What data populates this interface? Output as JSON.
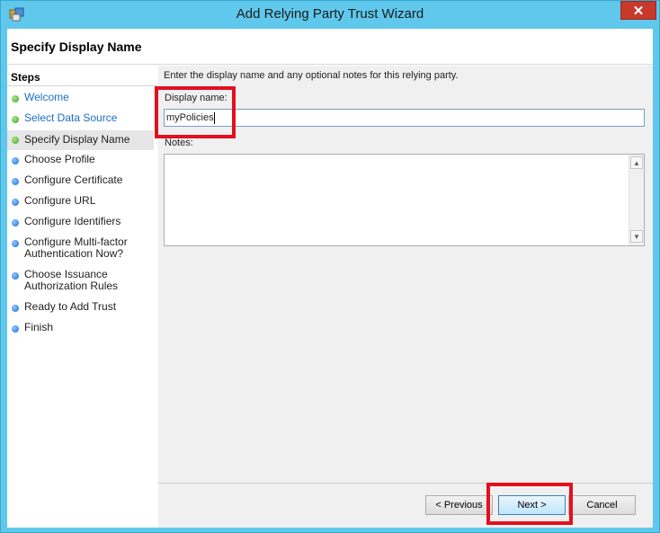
{
  "window": {
    "title": "Add Relying Party Trust Wizard",
    "close_glyph": "✕",
    "icon": "wizard-app-icon"
  },
  "header": {
    "title": "Specify Display Name"
  },
  "steps": {
    "heading": "Steps",
    "items": [
      {
        "label": "Welcome",
        "state": "done",
        "dot_color": "#3ea420"
      },
      {
        "label": "Select Data Source",
        "state": "done",
        "dot_color": "#3ea420"
      },
      {
        "label": "Specify Display Name",
        "state": "current",
        "dot_color": "#3ea420"
      },
      {
        "label": "Choose Profile",
        "state": "pending",
        "dot_color": "#1e6fd8"
      },
      {
        "label": "Configure Certificate",
        "state": "pending",
        "dot_color": "#1e6fd8"
      },
      {
        "label": "Configure URL",
        "state": "pending",
        "dot_color": "#1e6fd8"
      },
      {
        "label": "Configure Identifiers",
        "state": "pending",
        "dot_color": "#1e6fd8"
      },
      {
        "label": "Configure Multi-factor Authentication Now?",
        "state": "pending",
        "dot_color": "#1e6fd8"
      },
      {
        "label": "Choose Issuance Authorization Rules",
        "state": "pending",
        "dot_color": "#1e6fd8"
      },
      {
        "label": "Ready to Add Trust",
        "state": "pending",
        "dot_color": "#1e6fd8"
      },
      {
        "label": "Finish",
        "state": "pending",
        "dot_color": "#1e6fd8"
      }
    ]
  },
  "form": {
    "instruction": "Enter the display name and any optional notes for this relying party.",
    "display_name_label": "Display name:",
    "display_name_value": "myPolicies",
    "notes_label": "Notes:",
    "notes_value": ""
  },
  "buttons": {
    "previous": "< Previous",
    "next": "Next >",
    "cancel": "Cancel"
  },
  "colors": {
    "title_bar": "#5fc8ec",
    "highlight": "#e3101f",
    "link": "#1a6fc4"
  }
}
